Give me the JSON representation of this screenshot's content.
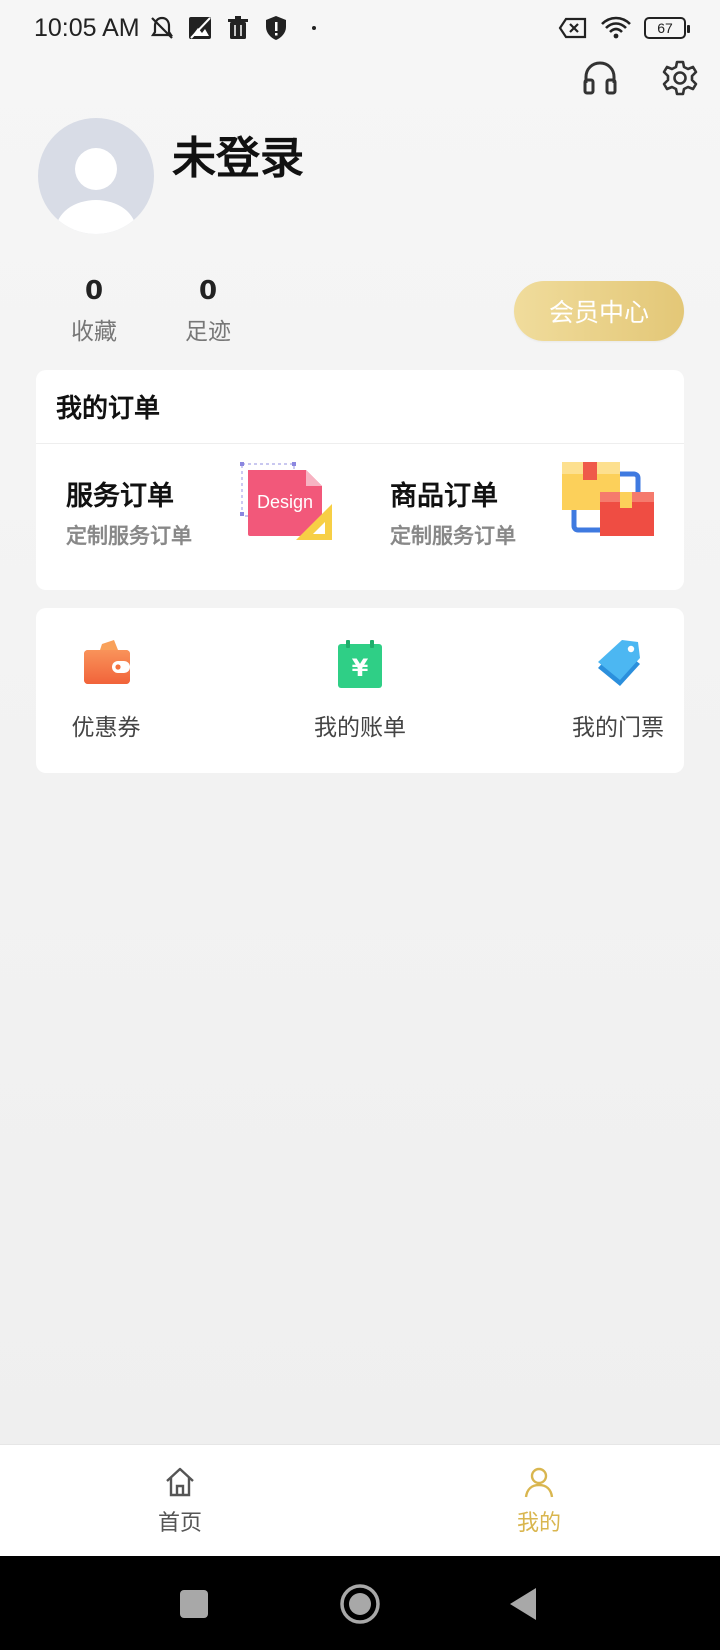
{
  "status_bar": {
    "time": "10:05 AM",
    "battery": "67"
  },
  "profile": {
    "name": "未登录"
  },
  "stats": [
    {
      "value": "0",
      "label": "收藏"
    },
    {
      "value": "0",
      "label": "足迹"
    }
  ],
  "member_button": "会员中心",
  "orders": {
    "title": "我的订单",
    "items": [
      {
        "title": "服务订单",
        "subtitle": "定制服务订单",
        "illustration_text": "Design"
      },
      {
        "title": "商品订单",
        "subtitle": "定制服务订单"
      }
    ]
  },
  "tools": [
    {
      "label": "优惠券",
      "icon": "wallet-icon"
    },
    {
      "label": "我的账单",
      "icon": "bill-icon"
    },
    {
      "label": "我的门票",
      "icon": "ticket-icon"
    }
  ],
  "tab_bar": {
    "home": "首页",
    "mine": "我的"
  },
  "colors": {
    "accent_gold": "#d9b64f",
    "member_gradient_start": "#f0dc9c",
    "member_gradient_end": "#e3c777"
  }
}
